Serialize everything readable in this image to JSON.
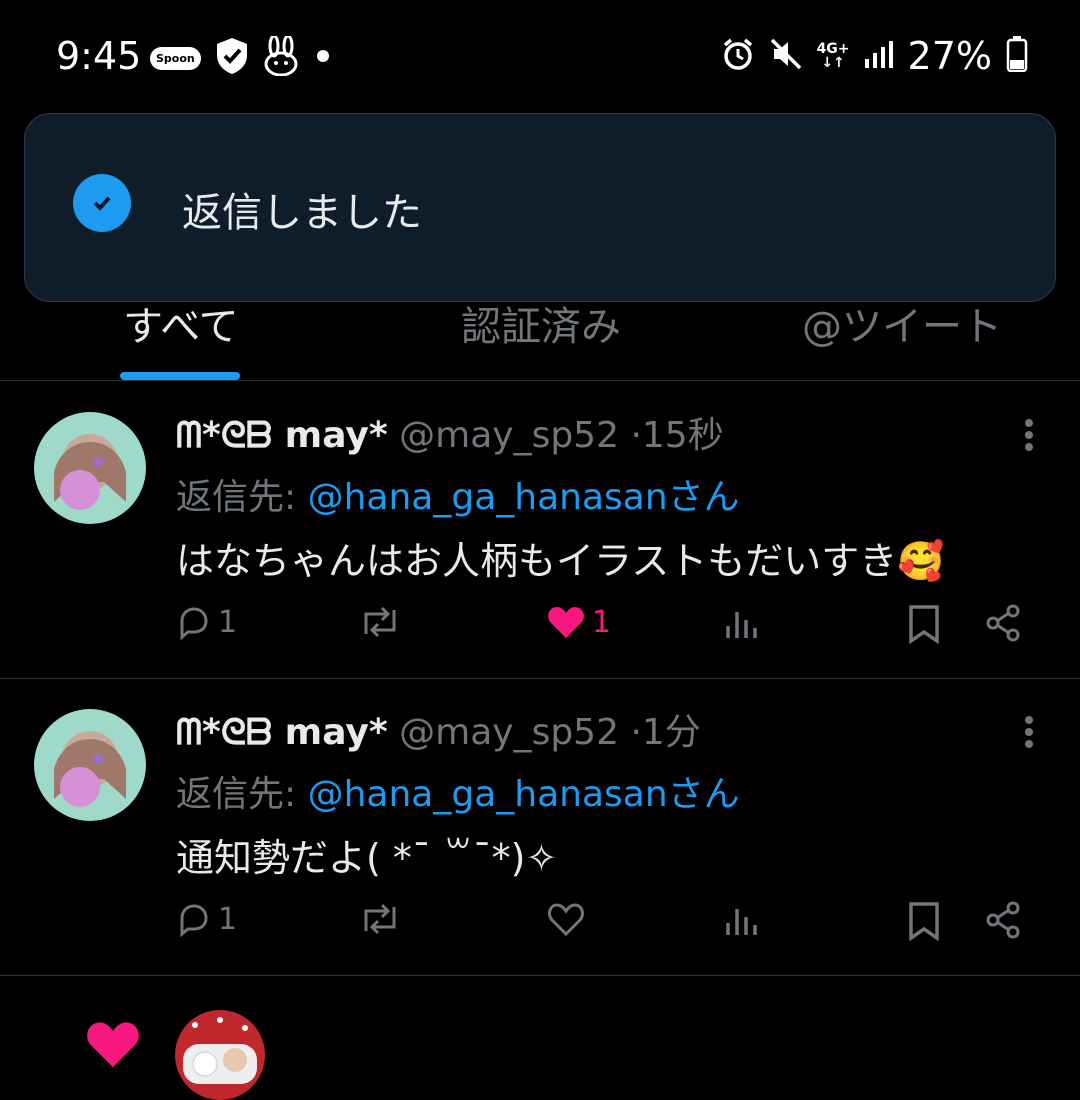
{
  "status_bar": {
    "time": "9:45",
    "spoon_label": "Spoon",
    "network": "4G+",
    "battery": "27%",
    "icons": [
      "spoon-badge-icon",
      "shield-check-icon",
      "rabbit-icon",
      "dot-icon",
      "alarm-icon",
      "mute-icon",
      "network-icon",
      "signal-icon",
      "battery-icon"
    ]
  },
  "toast": {
    "text": "返信しました",
    "icon": "check-circle-icon"
  },
  "tabs": {
    "items": [
      "すべて",
      "認証済み",
      "@ツイート"
    ],
    "active_index": 0
  },
  "tweets": [
    {
      "name": "ᗰ*ᘓᗷ may*",
      "handle": "@may_sp52",
      "time": "15秒",
      "reply_label": "返信先:",
      "reply_to": "@hana_ga_hanasanさん",
      "text": "はなちゃんはお人柄もイラストもだいすき🥰",
      "reply_count": "1",
      "retweet_count": "",
      "like_count": "1",
      "liked": true
    },
    {
      "name": "ᗰ*ᘓᗷ may*",
      "handle": "@may_sp52",
      "time": "1分",
      "reply_label": "返信先:",
      "reply_to": "@hana_ga_hanasanさん",
      "text": "通知勢だよ( *¯ ꒳¯*)✧",
      "reply_count": "1",
      "retweet_count": "",
      "like_count": "",
      "liked": false
    }
  ],
  "colors": {
    "accent": "#1d9bf0",
    "like": "#f91880",
    "muted": "#71767b",
    "toast_bg": "#0f1d2b"
  }
}
